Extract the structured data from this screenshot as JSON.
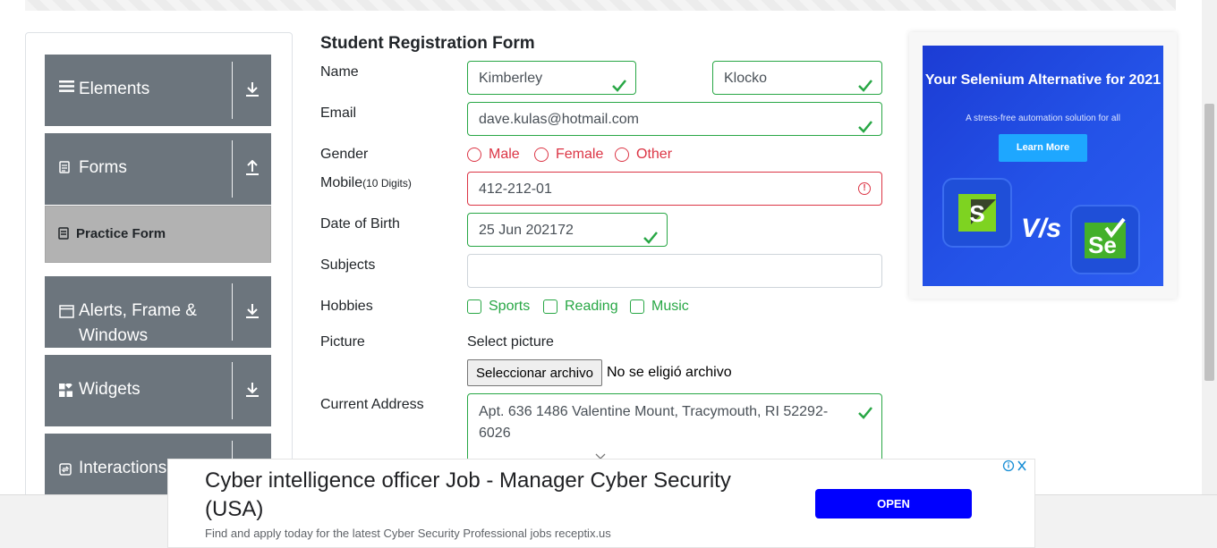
{
  "sidebar": {
    "groups": [
      {
        "title": "Elements",
        "icon": "hamburger-icon",
        "arrow": "down"
      },
      {
        "title": "Forms",
        "icon": "document-icon",
        "arrow": "up"
      },
      {
        "title": "Alerts, Frame & Windows",
        "icon": "window-icon",
        "arrow": "down"
      },
      {
        "title": "Widgets",
        "icon": "widgets-icon",
        "arrow": "down"
      },
      {
        "title": "Interactions",
        "icon": "interactions-icon",
        "arrow": "down"
      }
    ],
    "active_item": "Practice Form"
  },
  "form": {
    "title": "Student Registration Form",
    "labels": {
      "name": "Name",
      "email": "Email",
      "gender": "Gender",
      "mobile": "Mobile",
      "mobile_hint": "(10 Digits)",
      "dob": "Date of Birth",
      "subjects": "Subjects",
      "hobbies": "Hobbies",
      "picture": "Picture",
      "address": "Current Address"
    },
    "first_name": "Kimberley",
    "last_name": "Klocko",
    "email": "dave.kulas@hotmail.com",
    "gender_options": [
      "Male",
      "Female",
      "Other"
    ],
    "mobile": "412-212-01",
    "dob": "25 Jun 202172",
    "subjects": "",
    "hobby_options": [
      "Sports",
      "Reading",
      "Music"
    ],
    "select_picture": "Select picture",
    "file_button": "Seleccionar archivo",
    "file_status": "No se eligió archivo",
    "address": "Apt. 636 1486 Valentine Mount, Tracymouth, RI 52292-6026"
  },
  "side_ad": {
    "headline": "Your Selenium Alternative for 2021",
    "sub": "A stress-free automation solution for all",
    "button": "Learn More",
    "logo_left": "S",
    "logo_right": "Se",
    "vs": "V/s"
  },
  "bottom_ad": {
    "headline": "Cyber intelligence officer Job - Manager Cyber Security (USA)",
    "description": "Find and apply today for the latest Cyber Security Professional jobs receptix.us",
    "button": "OPEN"
  },
  "colors": {
    "valid": "#28a745",
    "invalid": "#dc3545",
    "sidebar": "#6c757d",
    "ad_blue": "#0000ff"
  }
}
